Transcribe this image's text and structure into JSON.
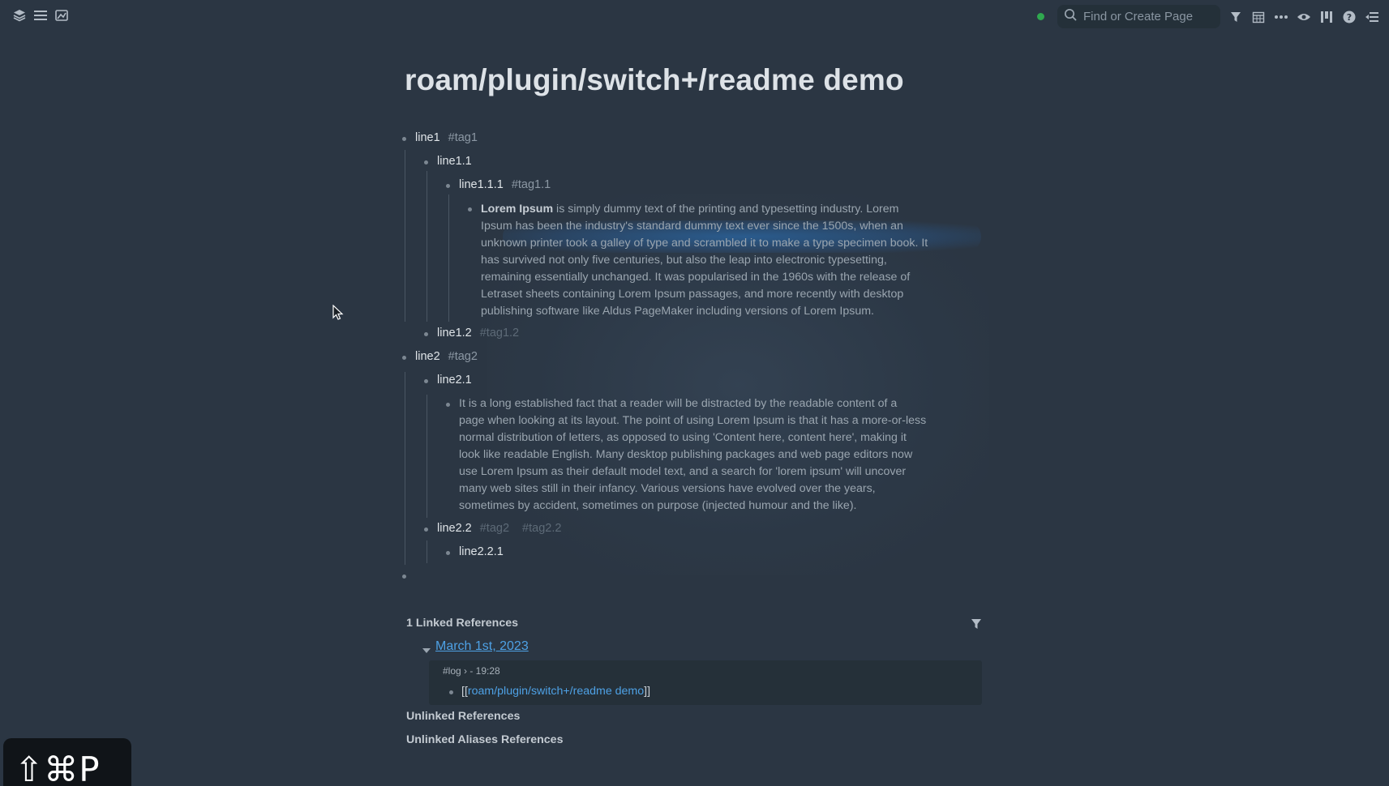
{
  "topbar": {
    "left_icons": [
      "layers-icon",
      "menu-icon",
      "graph-icon"
    ],
    "search_placeholder": "Find or Create Page",
    "right_icons": [
      "filter-icon",
      "calendar-icon",
      "more-icon",
      "eye-icon",
      "columns-icon",
      "help-icon",
      "sidebar-icon"
    ],
    "status_color": "#2fa84f"
  },
  "page": {
    "title": "roam/plugin/switch+/readme demo"
  },
  "blocks": {
    "line1": {
      "text": "line1",
      "tag": "#tag1"
    },
    "line1_1": {
      "text": "line1.1"
    },
    "line1_1_1": {
      "text": "line1.1.1",
      "tag": "#tag1.1"
    },
    "lorem_bold": "Lorem Ipsum",
    "lorem_lines": [
      " is simply dummy text of the printing and typesetting industry. Lorem",
      "Ipsum has been the industry's standard dummy text ever since the 1500s, when an",
      "unknown printer took a galley of type and scrambled it to make a type specimen book. It",
      "has survived not only five centuries, but also the leap into electronic typesetting,",
      "remaining essentially unchanged. It was popularised in the 1960s with the release of",
      "Letraset sheets containing Lorem Ipsum passages, and more recently with desktop",
      "publishing software like Aldus PageMaker including versions of Lorem Ipsum."
    ],
    "line1_2": {
      "text": "line1.2",
      "tag": "#tag1.2"
    },
    "line2": {
      "text": "line2",
      "tag": "#tag2"
    },
    "line2_1": {
      "text": "line2.1"
    },
    "fact_lines": [
      "It is a long established fact that a reader will be distracted by the readable content of a",
      "page when looking at its layout. The point of using Lorem Ipsum is that it has a more-or-less",
      "normal distribution of letters, as opposed to using 'Content here, content here', making it",
      "look like readable English. Many desktop publishing packages and web page editors now",
      "use Lorem Ipsum as their default model text, and a search for 'lorem ipsum' will uncover",
      "many web sites still in their infancy. Various versions have evolved over the years,",
      "sometimes by accident, sometimes on purpose (injected humour and the like)."
    ],
    "line2_2": {
      "text": "line2.2",
      "tag_a": "#tag2",
      "tag_b": "#tag2.2"
    },
    "line2_2_1": {
      "text": "line2.2.1"
    }
  },
  "references": {
    "linked_header": "1 Linked References",
    "date_link": "March 1st, 2023",
    "crumb": "#log  ›  - 19:28",
    "ref_prefix": "[[",
    "ref_link": "roam/plugin/switch+/readme demo",
    "ref_suffix": "]]",
    "unlinked_header": "Unlinked References",
    "unlinked_aliases_header": "Unlinked Aliases References"
  },
  "shortcut_badge": "⇧⌘P"
}
